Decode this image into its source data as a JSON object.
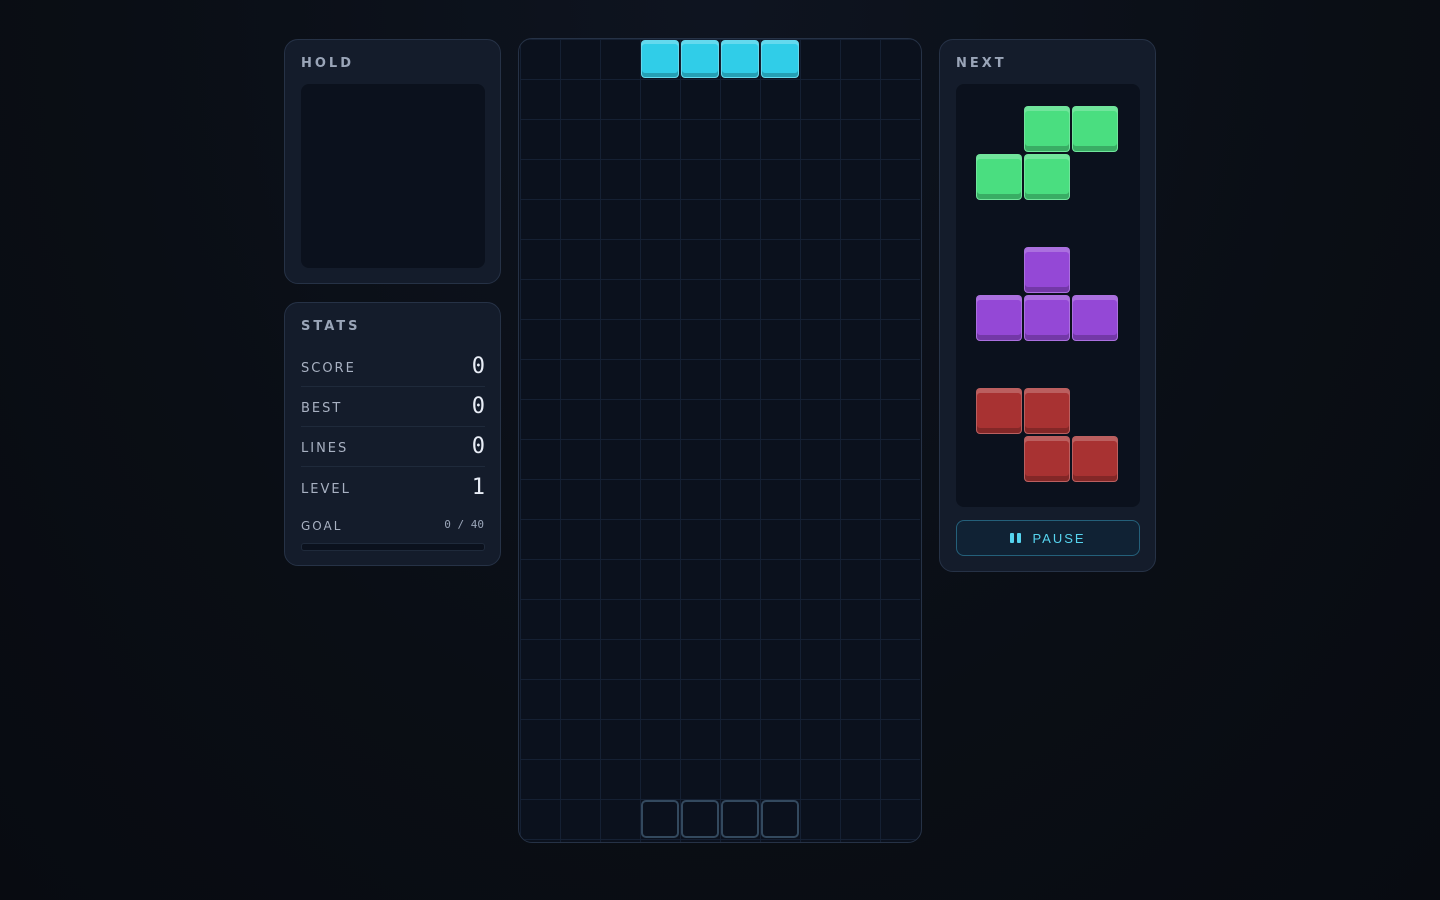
{
  "hold": {
    "title": "HOLD"
  },
  "stats": {
    "title": "STATS",
    "rows": [
      {
        "label": "SCORE",
        "value": "0"
      },
      {
        "label": "BEST",
        "value": "0"
      },
      {
        "label": "LINES",
        "value": "0"
      },
      {
        "label": "LEVEL",
        "value": "1"
      }
    ],
    "goal": {
      "label": "GOAL",
      "value": "0 / 40",
      "progress": 0
    }
  },
  "board": {
    "columns": 10,
    "rows": 20,
    "active_piece": {
      "type": "I",
      "color": "#30cde8",
      "cells": [
        [
          3,
          0
        ],
        [
          4,
          0
        ],
        [
          5,
          0
        ],
        [
          6,
          0
        ]
      ]
    },
    "ghost_piece": {
      "color": "#33495e",
      "cells": [
        [
          3,
          19
        ],
        [
          4,
          19
        ],
        [
          5,
          19
        ],
        [
          6,
          19
        ]
      ]
    }
  },
  "next": {
    "title": "NEXT",
    "pieces": [
      {
        "type": "S",
        "color": "#4ade80",
        "cells": [
          [
            1,
            0
          ],
          [
            2,
            0
          ],
          [
            0,
            1
          ],
          [
            1,
            1
          ]
        ]
      },
      {
        "type": "T",
        "color": "#9448d6",
        "cells": [
          [
            1,
            0
          ],
          [
            0,
            1
          ],
          [
            1,
            1
          ],
          [
            2,
            1
          ]
        ]
      },
      {
        "type": "Z",
        "color": "#a83232",
        "cells": [
          [
            0,
            0
          ],
          [
            1,
            0
          ],
          [
            1,
            1
          ],
          [
            2,
            1
          ]
        ]
      }
    ],
    "pause_label": "PAUSE"
  }
}
